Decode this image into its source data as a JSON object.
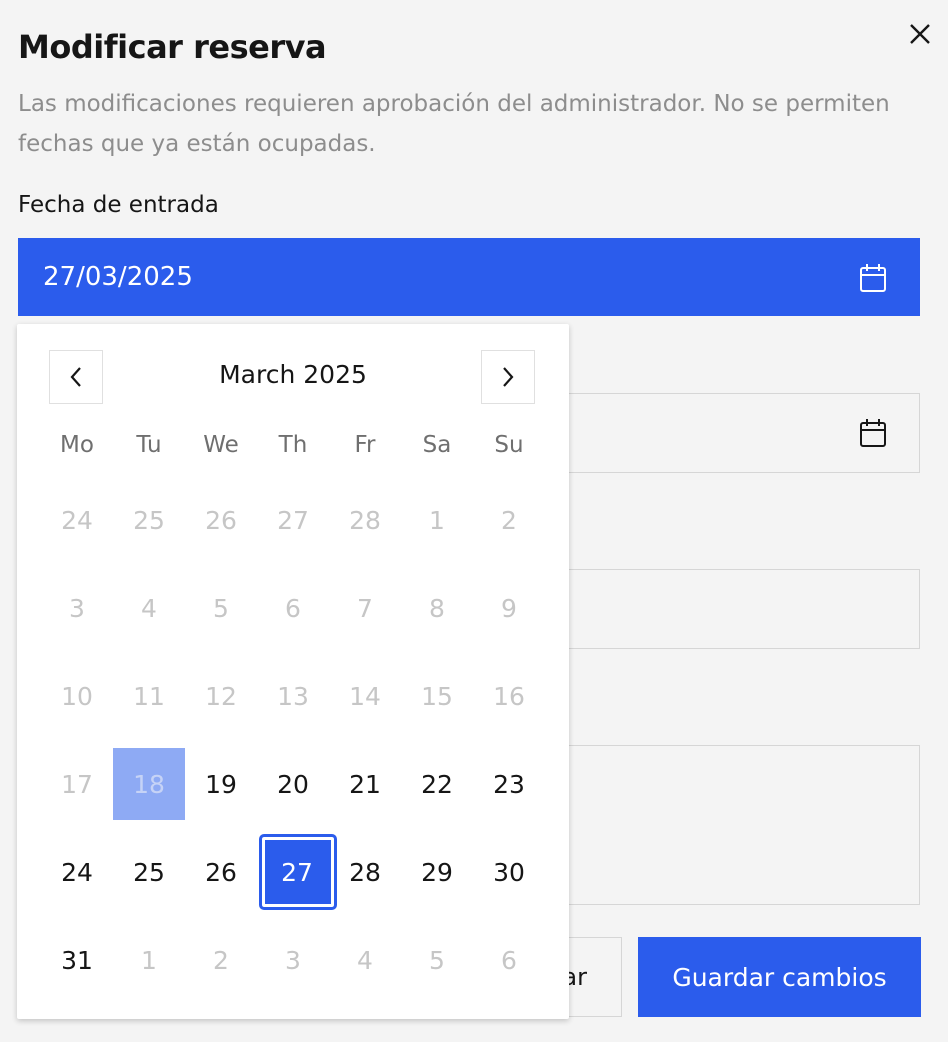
{
  "modal": {
    "title": "Modificar reserva",
    "description": "Las modificaciones requieren aprobación del administrador. No se permiten fechas que ya están ocupadas.",
    "checkin_label": "Fecha de entrada",
    "checkin_value": "27/03/2025",
    "secondary_button_label": "ar",
    "primary_button_label": "Guardar cambios",
    "close_icon": "close-icon"
  },
  "calendar": {
    "month_label": "March 2025",
    "prev_icon": "chevron-left-icon",
    "next_icon": "chevron-right-icon",
    "weekdays": [
      "Mo",
      "Tu",
      "We",
      "Th",
      "Fr",
      "Sa",
      "Su"
    ],
    "days": [
      {
        "label": "24",
        "state": "muted"
      },
      {
        "label": "25",
        "state": "muted"
      },
      {
        "label": "26",
        "state": "muted"
      },
      {
        "label": "27",
        "state": "muted"
      },
      {
        "label": "28",
        "state": "muted"
      },
      {
        "label": "1",
        "state": "muted"
      },
      {
        "label": "2",
        "state": "muted"
      },
      {
        "label": "3",
        "state": "muted"
      },
      {
        "label": "4",
        "state": "muted"
      },
      {
        "label": "5",
        "state": "muted"
      },
      {
        "label": "6",
        "state": "muted"
      },
      {
        "label": "7",
        "state": "muted"
      },
      {
        "label": "8",
        "state": "muted"
      },
      {
        "label": "9",
        "state": "muted"
      },
      {
        "label": "10",
        "state": "muted"
      },
      {
        "label": "11",
        "state": "muted"
      },
      {
        "label": "12",
        "state": "muted"
      },
      {
        "label": "13",
        "state": "muted"
      },
      {
        "label": "14",
        "state": "muted"
      },
      {
        "label": "15",
        "state": "muted"
      },
      {
        "label": "16",
        "state": "muted"
      },
      {
        "label": "17",
        "state": "muted"
      },
      {
        "label": "18",
        "state": "highlight"
      },
      {
        "label": "19",
        "state": "normal"
      },
      {
        "label": "20",
        "state": "normal"
      },
      {
        "label": "21",
        "state": "normal"
      },
      {
        "label": "22",
        "state": "normal"
      },
      {
        "label": "23",
        "state": "normal"
      },
      {
        "label": "24",
        "state": "normal"
      },
      {
        "label": "25",
        "state": "normal"
      },
      {
        "label": "26",
        "state": "normal"
      },
      {
        "label": "27",
        "state": "selected"
      },
      {
        "label": "28",
        "state": "normal"
      },
      {
        "label": "29",
        "state": "normal"
      },
      {
        "label": "30",
        "state": "normal"
      },
      {
        "label": "31",
        "state": "normal"
      },
      {
        "label": "1",
        "state": "muted"
      },
      {
        "label": "2",
        "state": "muted"
      },
      {
        "label": "3",
        "state": "muted"
      },
      {
        "label": "4",
        "state": "muted"
      },
      {
        "label": "5",
        "state": "muted"
      },
      {
        "label": "6",
        "state": "muted"
      }
    ]
  },
  "colors": {
    "accent": "#2b5cec",
    "today_highlight": "#8eaaf4",
    "muted_text": "#c6c6c6",
    "background": "#f4f4f4"
  }
}
